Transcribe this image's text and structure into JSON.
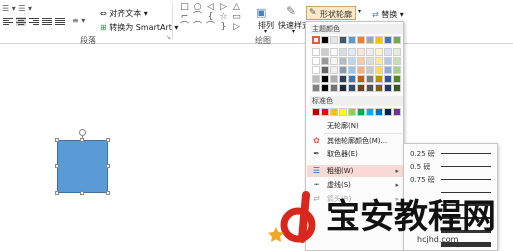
{
  "ribbon": {
    "align_text_label": "对齐文本",
    "convert_smartart_label": "转换为 SmartArt",
    "paragraph_group": "段落",
    "drawing_group": "绘图",
    "arrange_label": "排列",
    "quick_styles_label": "快速样式",
    "shape_outline_label": "形状轮廓",
    "replace_label": "替换",
    "shape_glyphs": [
      "□",
      "○",
      "◁",
      "▷",
      "△",
      "⌐",
      "⌒",
      "{",
      "☆",
      "▭",
      "⌒",
      "⌒",
      "⌒",
      "}",
      "▷"
    ]
  },
  "menu": {
    "theme_colors_heading": "主题颜色",
    "standard_colors_heading": "标准色",
    "no_outline_label": "无轮廓(N)",
    "more_colors_label": "其他轮廓颜色(M)...",
    "eyedropper_label": "取色器(E)",
    "weight_label": "粗细(W)",
    "dashes_label": "虚线(S)",
    "arrows_label": "箭头(R)",
    "theme_top_row": [
      "#ffffff",
      "#000000",
      "#e7e6e6",
      "#44546a",
      "#5b9bd5",
      "#ed7d31",
      "#a5a5a5",
      "#ffc000",
      "#4472c4",
      "#70ad47"
    ],
    "standard_colors": [
      "#c00000",
      "#ff0000",
      "#ffc000",
      "#ffff00",
      "#92d050",
      "#00b050",
      "#00b0f0",
      "#0070c0",
      "#002060",
      "#7030a0"
    ]
  },
  "submenu": {
    "weights": [
      {
        "label": "0.25 磅",
        "thickness": 0.25
      },
      {
        "label": "0.5 磅",
        "thickness": 0.5
      },
      {
        "label": "0.75 磅",
        "thickness": 0.75
      },
      {
        "label": "",
        "thickness": 1
      },
      {
        "label": "",
        "thickness": 1.5
      },
      {
        "label": "",
        "thickness": 2.25
      },
      {
        "label": "",
        "thickness": 3
      },
      {
        "label": "",
        "thickness": 4.5
      }
    ]
  },
  "watermark": {
    "title": "宝安教程网",
    "url": "hcjhd.com",
    "logo_color": "#d8271c"
  }
}
